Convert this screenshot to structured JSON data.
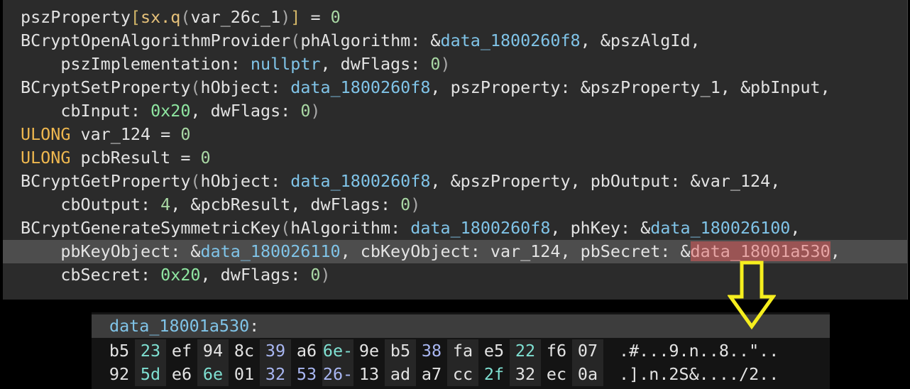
{
  "code": {
    "l1": {
      "a": "pszProperty",
      "b": "[",
      "c": "sx.q",
      "d": "(",
      "e": "var_26c_1",
      "f": ")",
      "g": "]",
      "h": " = ",
      "i": "0"
    },
    "l2": {
      "a": "BCryptOpenAlgorithmProvider",
      "b": "(",
      "c": "phAlgorithm: &",
      "d": "data_1800260f8",
      "e": ", &pszAlgId,"
    },
    "l3": {
      "a": "    pszImplementation: ",
      "b": "nullptr",
      "c": ", dwFlags: ",
      "d": "0",
      "e": ")"
    },
    "l4": {
      "a": "BCryptSetProperty",
      "b": "(",
      "c": "hObject: ",
      "d": "data_1800260f8",
      "e": ", pszProperty: &pszProperty_1, &pbInput,"
    },
    "l5": {
      "a": "    cbInput: ",
      "b": "0x20",
      "c": ", dwFlags: ",
      "d": "0",
      "e": ")"
    },
    "l6": {
      "a": "ULONG",
      "b": " var_124 = ",
      "c": "0"
    },
    "l7": {
      "a": "ULONG",
      "b": " pcbResult = ",
      "c": "0"
    },
    "l8": {
      "a": "BCryptGetProperty",
      "b": "(",
      "c": "hObject: ",
      "d": "data_1800260f8",
      "e": ", &pszProperty, pbOutput: &var_124,"
    },
    "l9": {
      "a": "    cbOutput: ",
      "b": "4",
      "c": ", &pcbResult, dwFlags: ",
      "d": "0",
      "e": ")"
    },
    "l10": {
      "a": "BCryptGenerateSymmetricKey",
      "b": "(",
      "c": "hAlgorithm: ",
      "d": "data_1800260f8",
      "e": ", phKey: &",
      "f": "data_180026100",
      "g": ","
    },
    "l11": {
      "a": "    pbKeyObject: &",
      "b": "data_180026110",
      "c": ", cbKeyObject: var_124, pbSecret: &",
      "d": "data_18001a530",
      "e": ","
    },
    "l12": {
      "a": "    cbSecret: ",
      "b": "0x20",
      "c": ", dwFlags: ",
      "d": "0",
      "e": ")"
    }
  },
  "hex": {
    "label": "data_18001a530",
    "colon": ":",
    "row1": [
      "b5",
      "23",
      "ef",
      "94",
      "8c",
      "39",
      "a6",
      "6e-",
      "9e",
      "b5",
      "38",
      "fa",
      "e5",
      "22",
      "f6",
      "07"
    ],
    "row1_ascii": ".#...9.n..8..\"..",
    "row2": [
      "92",
      "5d",
      "e6",
      "6e",
      "01",
      "32",
      "53",
      "26-",
      "13",
      "ad",
      "a7",
      "cc",
      "2f",
      "32",
      "ec",
      "0a"
    ],
    "row2_ascii": ".].n.2S&..../2.."
  },
  "colors": {
    "selection": "#9a5454",
    "highlight_line": "#4d4d4d",
    "arrow": "#f5ee1e"
  }
}
